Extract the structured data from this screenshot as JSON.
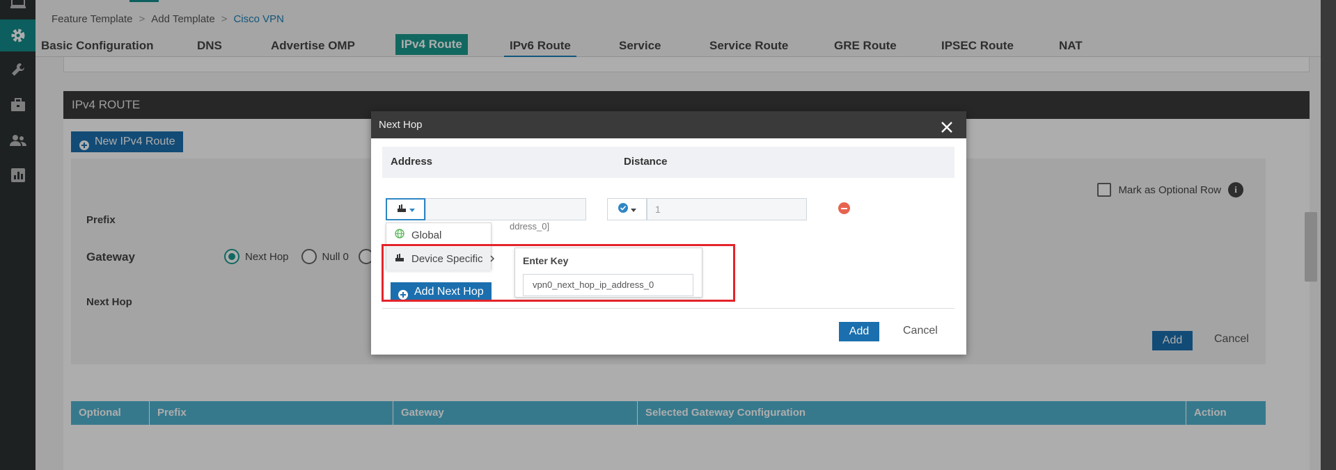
{
  "breadcrumb": {
    "items": [
      "Feature Template",
      "Add Template"
    ],
    "current": "Cisco VPN",
    "separator": ">"
  },
  "tabs": [
    {
      "label": "Basic Configuration",
      "active": false
    },
    {
      "label": "DNS",
      "active": false
    },
    {
      "label": "Advertise OMP",
      "active": false
    },
    {
      "label": "IPv4 Route",
      "active": true
    },
    {
      "label": "IPv6 Route",
      "active": false
    },
    {
      "label": "Service",
      "active": false
    },
    {
      "label": "Service Route",
      "active": false
    },
    {
      "label": "GRE Route",
      "active": false
    },
    {
      "label": "IPSEC Route",
      "active": false
    },
    {
      "label": "NAT",
      "active": false
    }
  ],
  "section": {
    "title": "IPv4 ROUTE",
    "new_button": "New IPv4 Route",
    "mark_optional": "Mark as Optional Row",
    "prefix_label": "Prefix",
    "gateway_label": "Gateway",
    "gateway_options": [
      "Next Hop",
      "Null 0"
    ],
    "next_hop_label": "Next Hop",
    "add_label": "Add",
    "cancel_label": "Cancel",
    "table_columns": [
      "Optional",
      "Prefix",
      "Gateway",
      "Selected Gateway Configuration",
      "Action"
    ]
  },
  "modal": {
    "title": "Next Hop",
    "columns": {
      "address": "Address",
      "distance": "Distance"
    },
    "distance_value": "1",
    "address_hint": "ddress_0]",
    "menu": {
      "global": "Global",
      "device_specific": "Device Specific"
    },
    "submenu": {
      "title": "Enter Key",
      "key_value": "vpn0_next_hop_ip_address_0"
    },
    "add_next_hop": "Add Next Hop",
    "add_label": "Add",
    "cancel_label": "Cancel"
  },
  "colors": {
    "accent_teal": "#1a9a8e",
    "primary_blue": "#1b6fae",
    "table_header": "#52b3cf",
    "annotation_red": "#e3242b",
    "remove_red": "#e8634f"
  }
}
